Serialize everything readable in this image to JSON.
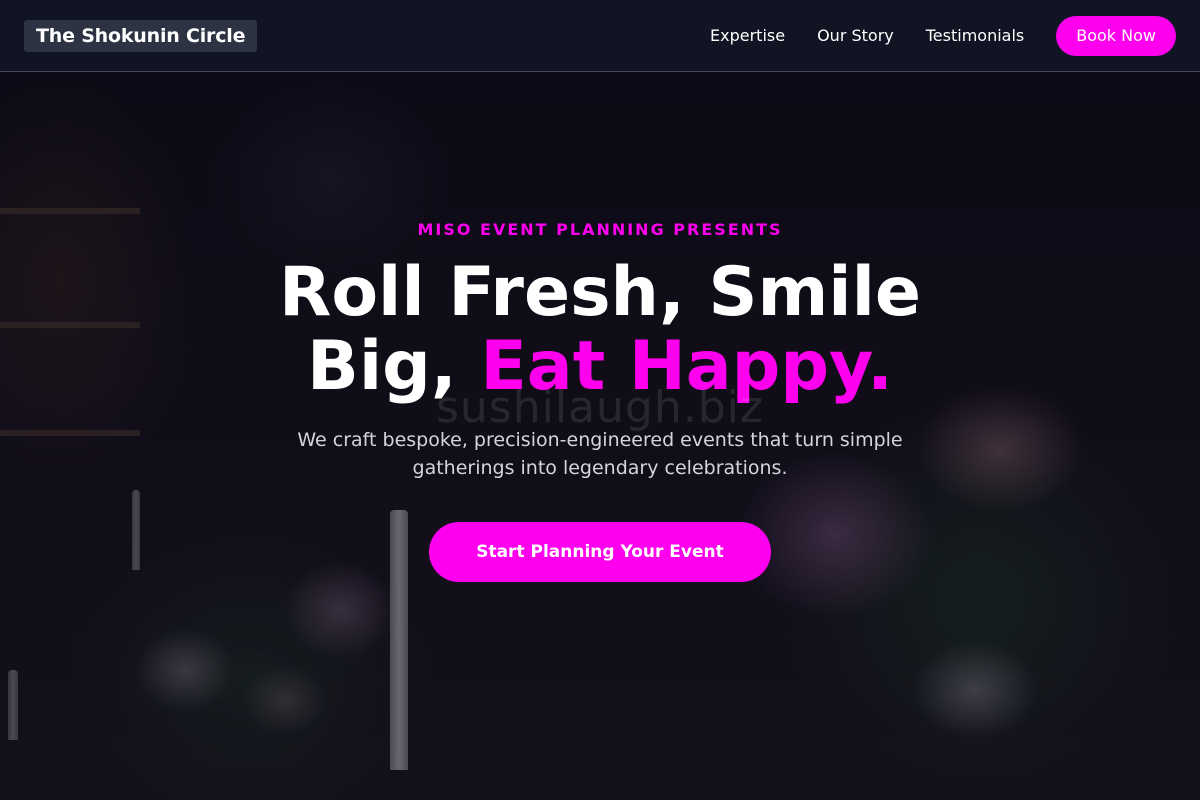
{
  "header": {
    "brand": "The Shokunin Circle",
    "nav": [
      "Expertise",
      "Our Story",
      "Testimonials"
    ],
    "cta_label": "Book Now"
  },
  "hero": {
    "eyebrow": "MISO EVENT PLANNING PRESENTS",
    "headline_line1": "Roll Fresh, Smile",
    "headline_line2_start": "Big, ",
    "headline_accent": "Eat Happy.",
    "watermark": "sushilaugh.biz",
    "subtitle": "We craft bespoke, precision-engineered events that turn simple gatherings into legendary celebrations.",
    "cta_label": "Start Planning Your Event"
  },
  "colors": {
    "accent": "#ff00ee",
    "header_bg": "#111626",
    "text": "#ffffff",
    "subtitle_text": "#d4d4dc"
  }
}
